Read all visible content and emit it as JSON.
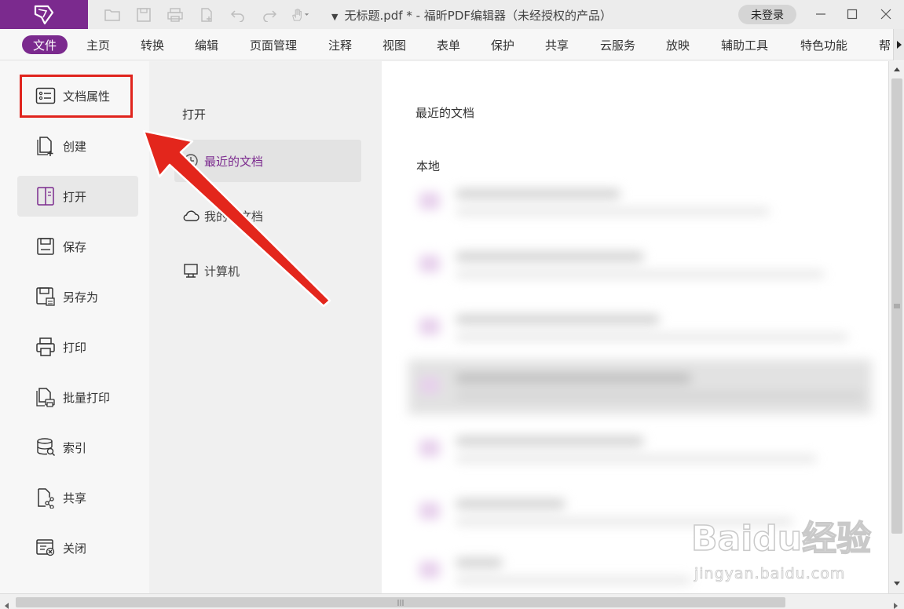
{
  "titlebar": {
    "title": "无标题.pdf * - 福昕PDF编辑器（未经授权的产品）",
    "login_label": "未登录",
    "brand_color": "#7b2a8e"
  },
  "menu": {
    "items": [
      "文件",
      "主页",
      "转换",
      "编辑",
      "页面管理",
      "注释",
      "视图",
      "表单",
      "保护",
      "共享",
      "云服务",
      "放映",
      "辅助工具",
      "特色功能",
      "帮"
    ],
    "active_index": 0
  },
  "leftnav": {
    "items": [
      {
        "label": "文档属性",
        "icon": "properties-icon"
      },
      {
        "label": "创建",
        "icon": "create-icon"
      },
      {
        "label": "打开",
        "icon": "open-icon"
      },
      {
        "label": "保存",
        "icon": "save-icon"
      },
      {
        "label": "另存为",
        "icon": "save-as-icon"
      },
      {
        "label": "打印",
        "icon": "print-icon"
      },
      {
        "label": "批量打印",
        "icon": "batch-print-icon"
      },
      {
        "label": "索引",
        "icon": "index-icon"
      },
      {
        "label": "共享",
        "icon": "share-icon"
      },
      {
        "label": "关闭",
        "icon": "close-file-icon"
      }
    ],
    "selected_index": 2
  },
  "middle": {
    "header": "打开",
    "items": [
      {
        "label": "最近的文档",
        "icon": "clock-icon"
      },
      {
        "label": "我的云文档",
        "icon": "cloud-icon"
      },
      {
        "label": "计算机",
        "icon": "computer-icon"
      }
    ],
    "selected_index": 0
  },
  "content": {
    "title": "最近的文档",
    "subtitle": "本地"
  },
  "watermark": {
    "main": "Baidu经验",
    "sub": "jingyan.baidu.com"
  }
}
